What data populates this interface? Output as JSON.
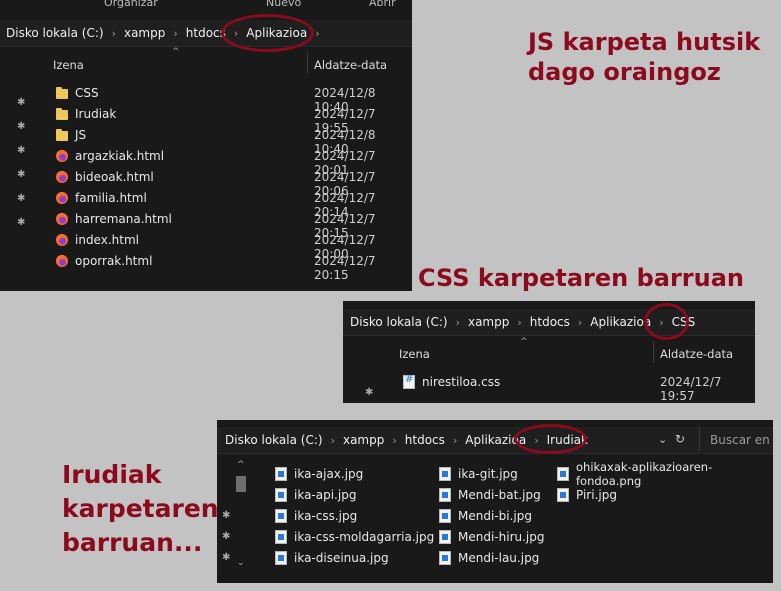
{
  "colors": {
    "accent": "#8b0a1e",
    "panel": "#191919",
    "page": "#c3c3c3"
  },
  "captions": {
    "js": [
      "JS karpeta hutsik",
      "dago oraingoz"
    ],
    "css": "CSS karpetaren barruan",
    "irudiak": [
      "Irudiak",
      "karpetaren",
      "barruan..."
    ]
  },
  "window1": {
    "ribbon": [
      "Organizar",
      "Nuevo",
      "Abrir"
    ],
    "breadcrumb": [
      "Disko lokala (C:)",
      "xampp",
      "htdocs",
      "Aplikazioa"
    ],
    "columns": {
      "name": "Izena",
      "date": "Aldatze-data"
    },
    "files": [
      {
        "name": "CSS",
        "date": "2024/12/8 10:40",
        "icon": "folder-icon"
      },
      {
        "name": "Irudiak",
        "date": "2024/12/7 19:55",
        "icon": "folder-icon"
      },
      {
        "name": "JS",
        "date": "2024/12/8 10:40",
        "icon": "folder-icon"
      },
      {
        "name": "argazkiak.html",
        "date": "2024/12/7 20:01",
        "icon": "firefox-icon"
      },
      {
        "name": "bideoak.html",
        "date": "2024/12/7 20:06",
        "icon": "firefox-icon"
      },
      {
        "name": "familia.html",
        "date": "2024/12/7 20:14",
        "icon": "firefox-icon"
      },
      {
        "name": "harremana.html",
        "date": "2024/12/7 20:15",
        "icon": "firefox-icon"
      },
      {
        "name": "index.html",
        "date": "2024/12/7 20:00",
        "icon": "firefox-icon"
      },
      {
        "name": "oporrak.html",
        "date": "2024/12/7 20:15",
        "icon": "firefox-icon"
      }
    ]
  },
  "window2": {
    "breadcrumb": [
      "Disko lokala (C:)",
      "xampp",
      "htdocs",
      "Aplikazioa",
      "CSS"
    ],
    "columns": {
      "name": "Izena",
      "date": "Aldatze-data"
    },
    "files": [
      {
        "name": "nirestiloa.css",
        "date": "2024/12/7 19:57",
        "icon": "css-file-icon"
      }
    ]
  },
  "window3": {
    "breadcrumb": [
      "Disko lokala (C:)",
      "xampp",
      "htdocs",
      "Aplikazioa",
      "Irudiak"
    ],
    "search_placeholder": "Buscar en Ir",
    "col1": [
      "ika-ajax.jpg",
      "ika-api.jpg",
      "ika-css.jpg",
      "ika-css-moldagarria.jpg",
      "ika-diseinua.jpg"
    ],
    "col2": [
      "ika-git.jpg",
      "Mendi-bat.jpg",
      "Mendi-bi.jpg",
      "Mendi-hiru.jpg",
      "Mendi-lau.jpg"
    ],
    "col3": [
      "ohikaxak-aplikazioaren-fondoa.png",
      "Piri.jpg"
    ]
  }
}
